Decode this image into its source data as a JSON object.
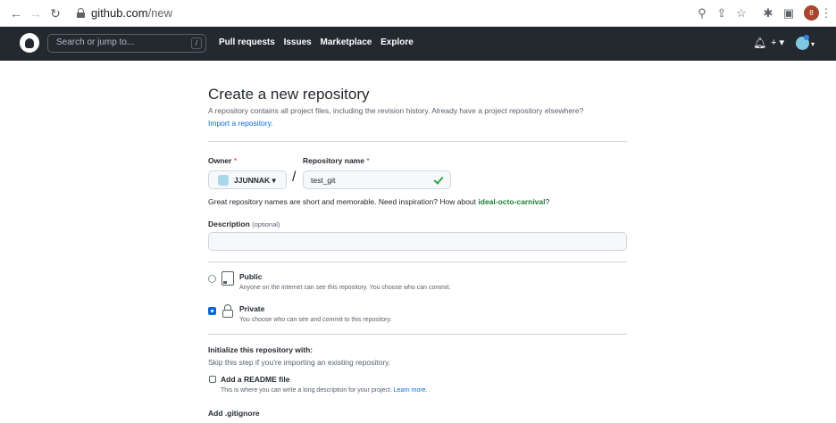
{
  "browser": {
    "url_host": "github.com",
    "url_path": "/new",
    "profile_initial": "8"
  },
  "header": {
    "search_placeholder": "Search or jump to...",
    "search_shortcut": "/",
    "nav": [
      "Pull requests",
      "Issues",
      "Marketplace",
      "Explore"
    ],
    "create_symbol": "+ ▾"
  },
  "page": {
    "title": "Create a new repository",
    "subtitle": "A repository contains all project files, including the revision history. Already have a project repository elsewhere?",
    "import_link": "Import a repository.",
    "owner_label": "Owner",
    "repo_name_label": "Repository name",
    "required_marker": "*",
    "owner_value": "JJUNNAK ▾",
    "separator": "/",
    "repo_name_value": "test_git",
    "hint_prefix": "Great repository names are short and memorable. Need inspiration? How about ",
    "hint_suggestion": "ideal-octo-carnival",
    "hint_suffix": "?",
    "description_label": "Description",
    "description_optional": "(optional)",
    "description_value": "",
    "visibility": [
      {
        "title": "Public",
        "description": "Anyone on the internet can see this repository. You choose who can commit.",
        "selected": false
      },
      {
        "title": "Private",
        "description": "You choose who can see and commit to this repository.",
        "selected": true
      }
    ],
    "init_title": "Initialize this repository with:",
    "init_subtitle": "Skip this step if you're importing an existing repository.",
    "readme_label": "Add a README file",
    "readme_desc": "This is where you can write a long description for your project. ",
    "readme_learn_more": "Learn more.",
    "gitignore_label": "Add .gitignore"
  },
  "colors": {
    "header_bg": "#24292f",
    "link": "#0969da",
    "success": "#2da44e",
    "required": "#cf222e"
  }
}
